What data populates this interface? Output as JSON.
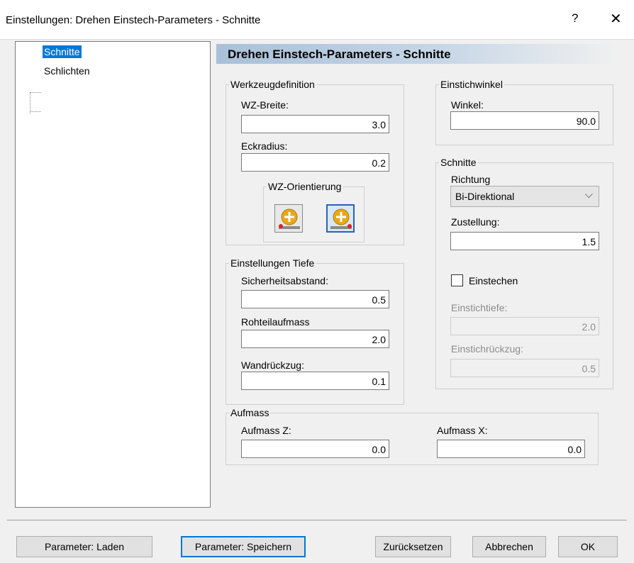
{
  "window": {
    "title": "Einstellungen: Drehen Einstech-Parameters - Schnitte",
    "help_label": "?",
    "close_label": "✕"
  },
  "tree": {
    "items": [
      {
        "label": "Schnitte",
        "selected": true
      },
      {
        "label": "Schlichten",
        "selected": false
      }
    ]
  },
  "header": {
    "title": "Drehen Einstech-Parameters - Schnitte"
  },
  "werkzeugdefinition": {
    "legend": "Werkzeugdefinition",
    "breite_label": "WZ-Breite:",
    "breite_value": "3.0",
    "eckradius_label": "Eckradius:",
    "eckradius_value": "0.2",
    "orientierung_legend": "WZ-Orientierung"
  },
  "tiefe": {
    "legend": "Einstellungen Tiefe",
    "sicherheit_label": "Sicherheitsabstand:",
    "sicherheit_value": "0.5",
    "rohteil_label": "Rohteilaufmass",
    "rohteil_value": "2.0",
    "wand_label": "Wandrückzug:",
    "wand_value": "0.1"
  },
  "einstichwinkel": {
    "legend": "Einstichwinkel",
    "winkel_label": "Winkel:",
    "winkel_value": "90.0"
  },
  "schnitte": {
    "legend": "Schnitte",
    "richtung_label": "Richtung",
    "richtung_value": "Bi-Direktional",
    "zustellung_label": "Zustellung:",
    "zustellung_value": "1.5",
    "einstechen_label": "Einstechen",
    "einstechen_checked": false,
    "einstichtiefe_label": "Einstichtiefe:",
    "einstichtiefe_value": "2.0",
    "einstichrueckzug_label": "Einstichrückzug:",
    "einstichrueckzug_value": "0.5"
  },
  "aufmass": {
    "legend": "Aufmass",
    "z_label": "Aufmass Z:",
    "z_value": "0.0",
    "x_label": "Aufmass X:",
    "x_value": "0.0"
  },
  "buttons": {
    "laden": "Parameter: Laden",
    "speichern": "Parameter: Speichern",
    "zuruecksetzen": "Zurücksetzen",
    "abbrechen": "Abbrechen",
    "ok": "OK"
  }
}
